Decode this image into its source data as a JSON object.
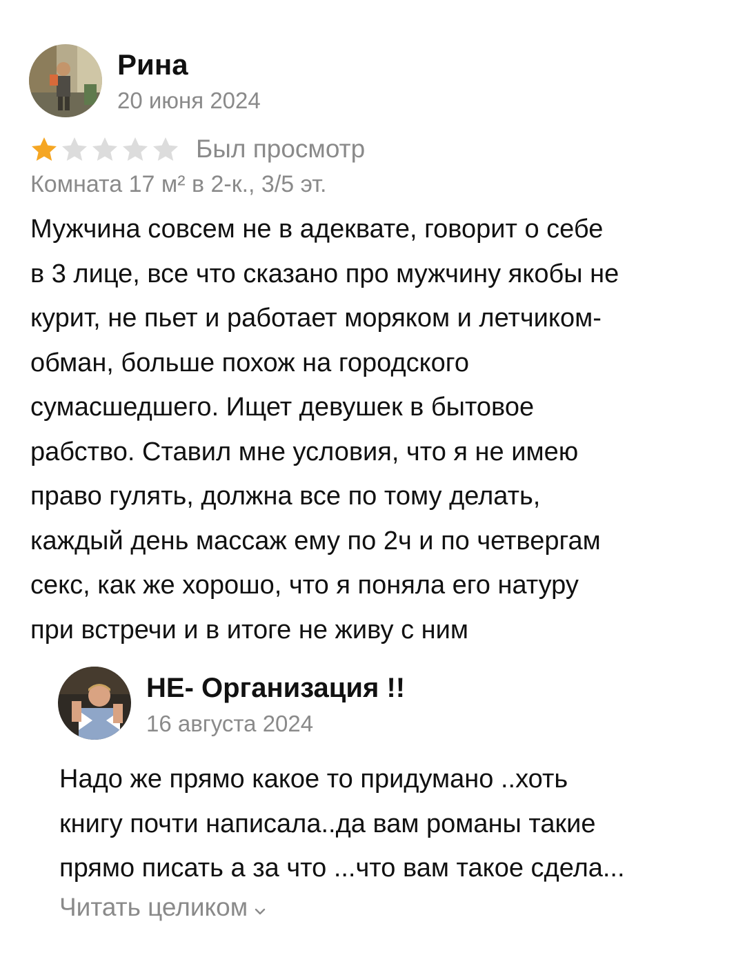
{
  "review": {
    "author": "Рина",
    "date": "20 июня 2024",
    "rating": 1,
    "rating_max": 5,
    "status": "Был просмотр",
    "details": "Комната 17 м² в 2-к., 3/5 эт.",
    "text": "Мужчина совсем не в адеквате, говорит о себе\nв 3 лице, все что сказано про мужчину якобы не\nкурит, не пьет и работает моряком и летчиком-\nобман, больше похож на городского\nсумасшедшего. Ищет девушек в бытовое\nрабство. Ставил мне условия, что я не имею\nправо гулять, должна все по тому делать,\nкаждый день массаж ему по 2ч и по четвергам\nсекс, как же хорошо, что я поняла его натуру\nпри встречи и в итоге не живу с ним"
  },
  "reply": {
    "author": "НЕ- Организация !!",
    "date": "16 августа 2024",
    "text": "Надо же прямо какое  то придумано ..хоть\nкнигу почти написала..да вам романы такие\nпрямо писать а за что ...что вам такое сдела...",
    "read_more_label": "Читать целиком"
  },
  "colors": {
    "star_filled": "#F5A623",
    "star_empty": "#DCDCDC",
    "secondary_text": "#8a8a8a",
    "primary_text": "#111111"
  }
}
